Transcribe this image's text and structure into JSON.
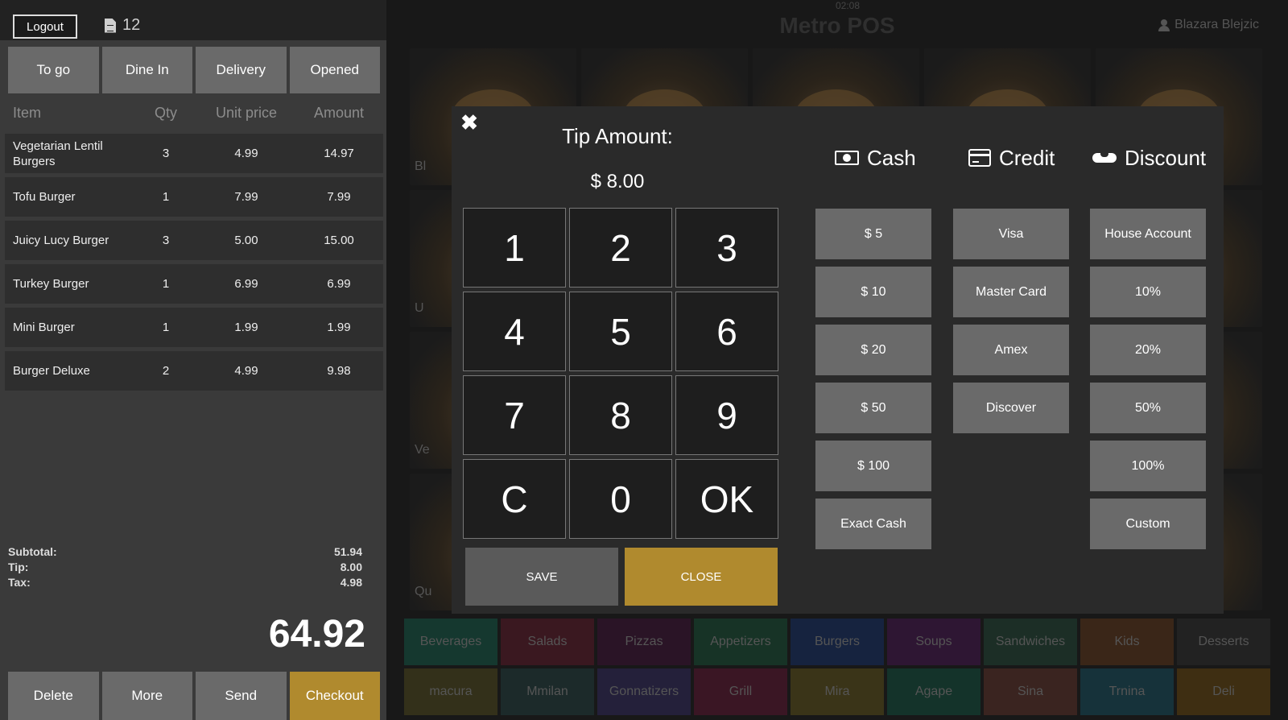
{
  "header": {
    "logout_label": "Logout",
    "order_icon": "document-icon",
    "order_number": "12",
    "brand": "Metro POS",
    "clock": "02:08",
    "user_name": "Blazara Blejzic"
  },
  "order_types": [
    "To go",
    "Dine In",
    "Delivery",
    "Opened"
  ],
  "columns": {
    "item": "Item",
    "qty": "Qty",
    "unit_price": "Unit price",
    "amount": "Amount"
  },
  "items": [
    {
      "name": "Vegetarian Lentil Burgers",
      "qty": "3",
      "unit_price": "4.99",
      "amount": "14.97"
    },
    {
      "name": "Tofu Burger",
      "qty": "1",
      "unit_price": "7.99",
      "amount": "7.99"
    },
    {
      "name": "Juicy Lucy Burger",
      "qty": "3",
      "unit_price": "5.00",
      "amount": "15.00"
    },
    {
      "name": "Turkey Burger",
      "qty": "1",
      "unit_price": "6.99",
      "amount": "6.99"
    },
    {
      "name": "Mini Burger",
      "qty": "1",
      "unit_price": "1.99",
      "amount": "1.99"
    },
    {
      "name": "Burger Deluxe",
      "qty": "2",
      "unit_price": "4.99",
      "amount": "9.98"
    }
  ],
  "totals": {
    "subtotal_label": "Subtotal:",
    "subtotal": "51.94",
    "tip_label": "Tip:",
    "tip": "8.00",
    "tax_label": "Tax:",
    "tax": "4.98",
    "grand_total": "64.92"
  },
  "bottom_actions": [
    "Delete",
    "More",
    "Send",
    "Checkout"
  ],
  "background_tiles": [
    "Bl",
    "",
    "",
    "",
    "",
    "U",
    "",
    "",
    "",
    "",
    "Ve",
    "",
    "",
    "",
    "",
    "Qu",
    "",
    "",
    "",
    ""
  ],
  "categories": [
    {
      "label": "Beverages",
      "color": "#15382f"
    },
    {
      "label": "Salads",
      "color": "#3a1820"
    },
    {
      "label": "Pizzas",
      "color": "#2a1426"
    },
    {
      "label": "Appetizers",
      "color": "#173326"
    },
    {
      "label": "Burgers",
      "color": "#16233f"
    },
    {
      "label": "Soups",
      "color": "#2e1633"
    },
    {
      "label": "Sandwiches",
      "color": "#1c2e26"
    },
    {
      "label": "Kids",
      "color": "#3a2618"
    },
    {
      "label": "Desserts",
      "color": "#222222"
    },
    {
      "label": "macura",
      "color": "#33301a"
    },
    {
      "label": "Mmilan",
      "color": "#1c2a2a"
    },
    {
      "label": "Gonnatizers",
      "color": "#24203a"
    },
    {
      "label": "Grill",
      "color": "#3a1624"
    },
    {
      "label": "Mira",
      "color": "#3a3418"
    },
    {
      "label": "Agape",
      "color": "#14332a"
    },
    {
      "label": "Sina",
      "color": "#3a2420"
    },
    {
      "label": "Trnina",
      "color": "#16323a"
    },
    {
      "label": "Deli",
      "color": "#3e2e12"
    }
  ],
  "modal": {
    "close_icon": "close-icon",
    "title": "Tip Amount:",
    "value": "$ 8.00",
    "keys": [
      "1",
      "2",
      "3",
      "4",
      "5",
      "6",
      "7",
      "8",
      "9",
      "C",
      "0",
      "OK"
    ],
    "save_label": "SAVE",
    "close_label": "CLOSE",
    "cash": {
      "label": "Cash",
      "icon": "cash-icon",
      "buttons": [
        "$  5",
        "$  10",
        "$  20",
        "$  50",
        "$  100",
        "Exact Cash"
      ]
    },
    "credit": {
      "label": "Credit",
      "icon": "credit-card-icon",
      "buttons": [
        "Visa",
        "Master Card",
        "Amex",
        "Discover"
      ]
    },
    "discount": {
      "label": "Discount",
      "icon": "handshake-icon",
      "buttons": [
        "House Account",
        "10%",
        "20%",
        "50%",
        "100%",
        "Custom"
      ]
    }
  },
  "colors": {
    "accent_gold": "#b08a2e",
    "button_gray": "#6a6a6a",
    "panel": "#3a3a3a"
  }
}
